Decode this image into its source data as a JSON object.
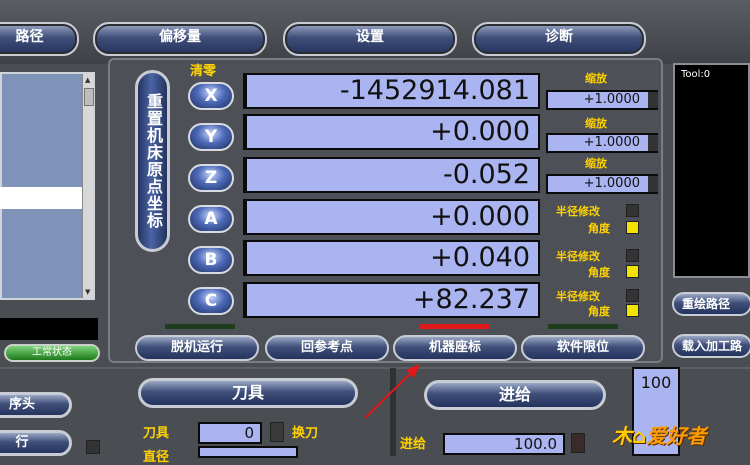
{
  "tabs": [
    "路径",
    "偏移量",
    "设置",
    "诊断"
  ],
  "left": {
    "status_label": "工常状态",
    "side_buttons": [
      "序头",
      "行"
    ]
  },
  "dro": {
    "clear_label": "清零",
    "ref_button": "重置机床原点坐标",
    "axes": [
      {
        "name": "X",
        "value": "-1452914.081"
      },
      {
        "name": "Y",
        "value": "+0.000"
      },
      {
        "name": "Z",
        "value": "-0.052"
      },
      {
        "name": "A",
        "value": "+0.000"
      },
      {
        "name": "B",
        "value": "+0.040"
      },
      {
        "name": "C",
        "value": "+82.237"
      }
    ],
    "scale_label": "缩放",
    "scales": [
      "+1.0000",
      "+1.0000",
      "+1.0000"
    ],
    "radius_label": "半径修改",
    "angle_label": "角度"
  },
  "buttons": {
    "offline_run": "脱机运行",
    "home_ref": "回参考点",
    "machine_coords": "机器座标",
    "soft_limits": "软件限位"
  },
  "right": {
    "tool_display": "Tool:0",
    "regen_path": "重绘路径",
    "load_gcode": "载入加工路"
  },
  "tool_panel": {
    "title": "刀具",
    "tool_label": "刀具",
    "tool_value": "0",
    "change_label": "换刀",
    "diameter_label": "直径"
  },
  "feed_panel": {
    "title": "进给",
    "feed_label": "进给",
    "feed_value": "100.0",
    "percent_value": "100"
  },
  "watermark": "爱好者",
  "colors": {
    "dro_bg": "#aab4f0",
    "label_yellow": "#ffd200",
    "button_blue": "#3f4f7a"
  }
}
